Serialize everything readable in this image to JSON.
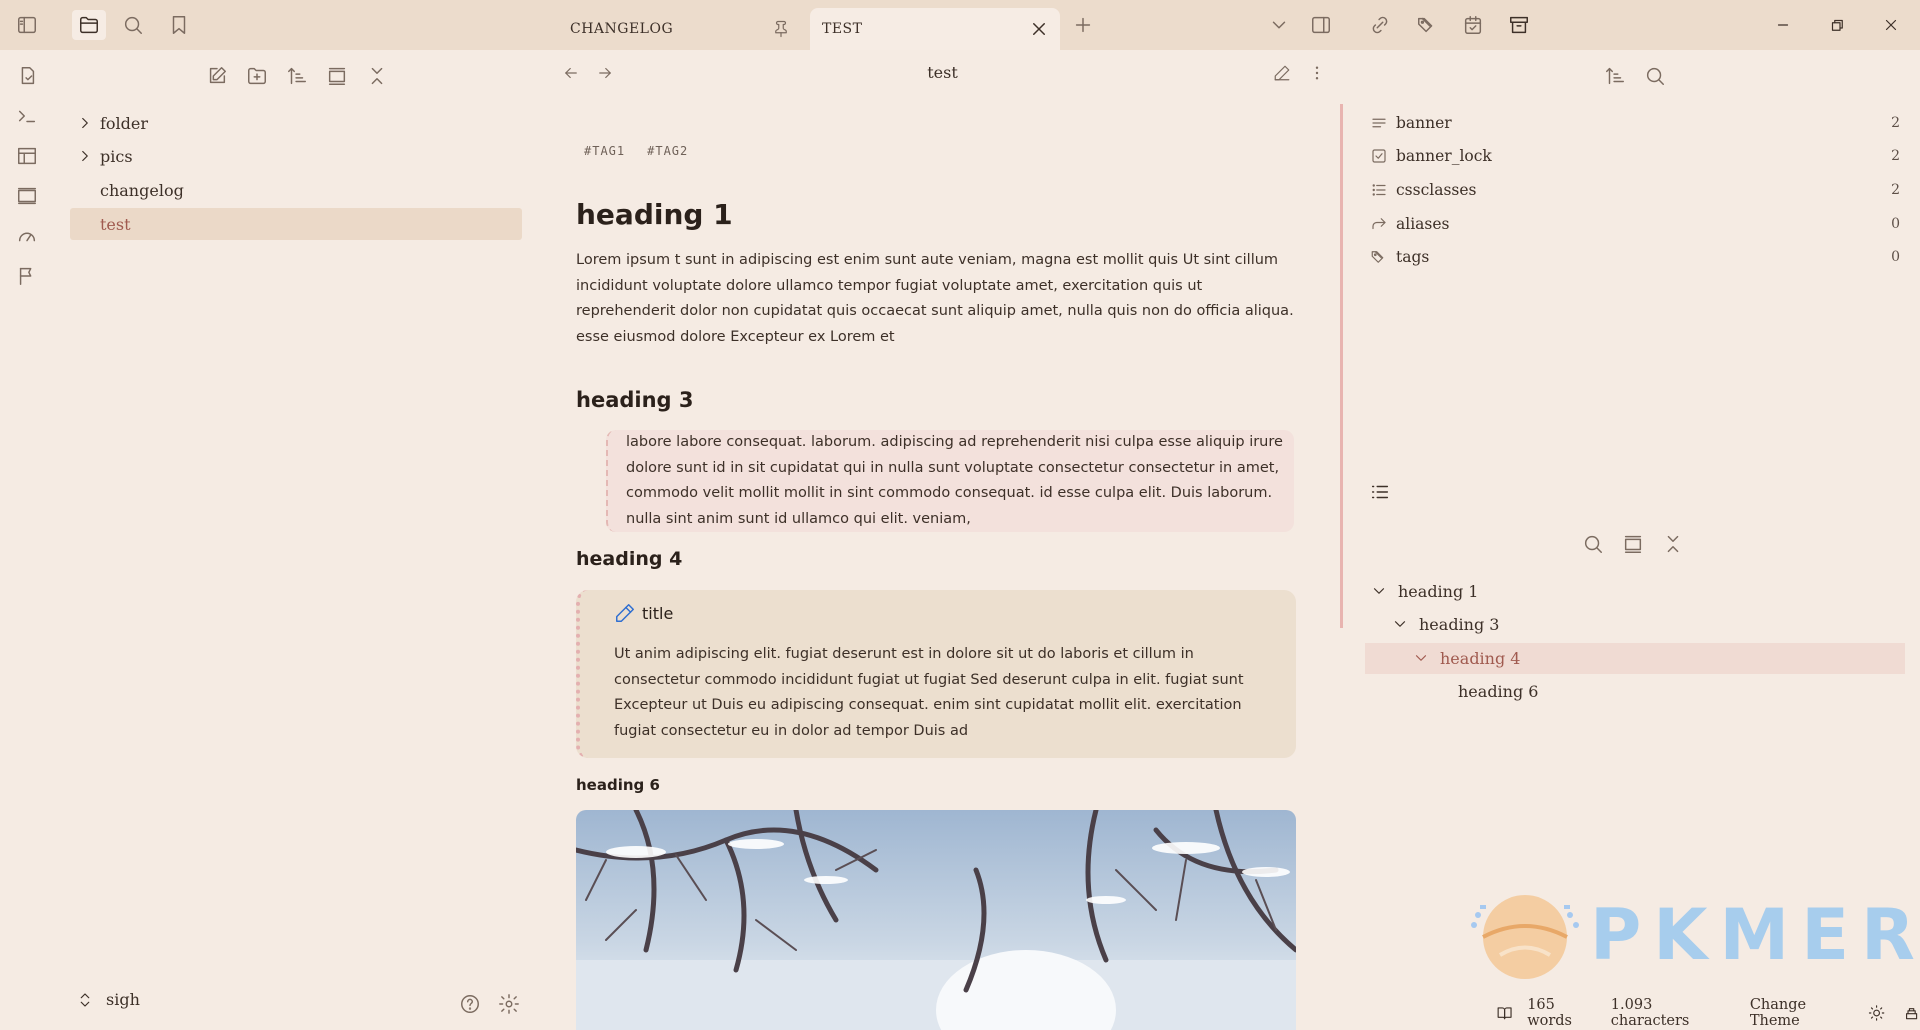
{
  "tabs": [
    {
      "label": "CHANGELOG",
      "active": false
    },
    {
      "label": "TEST",
      "active": true
    }
  ],
  "file_explorer": {
    "items": [
      {
        "label": "folder",
        "type": "folder"
      },
      {
        "label": "pics",
        "type": "folder"
      },
      {
        "label": "changelog",
        "type": "file"
      },
      {
        "label": "test",
        "type": "file",
        "selected": true
      }
    ],
    "vault_name": "sigh"
  },
  "editor": {
    "title": "test",
    "tags": [
      "#TAG1",
      "#TAG2"
    ],
    "heading1": "heading 1",
    "para1": "Lorem ipsum t sunt in adipiscing est enim sunt aute veniam, magna est mollit quis Ut sint cillum incididunt voluptate dolore ullamco tempor fugiat voluptate amet, exercitation quis ut reprehenderit dolor non cupidatat quis occaecat sunt aliquip amet, nulla quis non do officia aliqua. esse eiusmod dolore Excepteur ex Lorem et",
    "heading3": "heading 3",
    "quote": "labore labore consequat. laborum. adipiscing ad reprehenderit nisi culpa esse aliquip irure dolore sunt id in sit cupidatat qui in nulla sunt voluptate consectetur consectetur in amet, commodo velit mollit mollit in sint commodo consequat. id esse culpa elit. Duis laborum. nulla sint anim sunt id ullamco qui elit. veniam,",
    "heading4": "heading 4",
    "callout_title": "title",
    "callout_body": "Ut anim adipiscing elit. fugiat deserunt est in dolore sit ut do laboris et cillum in consectetur commodo incididunt fugiat ut fugiat Sed deserunt culpa in elit. fugiat sunt Excepteur ut Duis eu adipiscing consequat. enim sint cupidatat mollit elit. exercitation fugiat consectetur eu in dolor ad tempor Duis ad",
    "heading6": "heading 6"
  },
  "properties": [
    {
      "name": "banner",
      "count": "2",
      "icon": "lines-icon"
    },
    {
      "name": "banner_lock",
      "count": "2",
      "icon": "checkbox-icon"
    },
    {
      "name": "cssclasses",
      "count": "2",
      "icon": "list-icon"
    },
    {
      "name": "aliases",
      "count": "0",
      "icon": "forward-arrow-icon"
    },
    {
      "name": "tags",
      "count": "0",
      "icon": "tags-icon"
    }
  ],
  "outline": [
    {
      "label": "heading 1",
      "level": 1,
      "expanded": true
    },
    {
      "label": "heading 3",
      "level": 2,
      "expanded": true
    },
    {
      "label": "heading 4",
      "level": 3,
      "expanded": true,
      "active": true
    },
    {
      "label": "heading 6",
      "level": 4,
      "expanded": false
    }
  ],
  "watermark": {
    "text": "PKMER"
  },
  "status_bar": {
    "words": "165 words",
    "characters": "1.093 characters",
    "theme_button": "Change Theme"
  },
  "colors": {
    "background": "#f5ebe3",
    "titlebar": "#ecdccc",
    "selected": "#ebd9c8",
    "accent": "#a05a4f"
  }
}
